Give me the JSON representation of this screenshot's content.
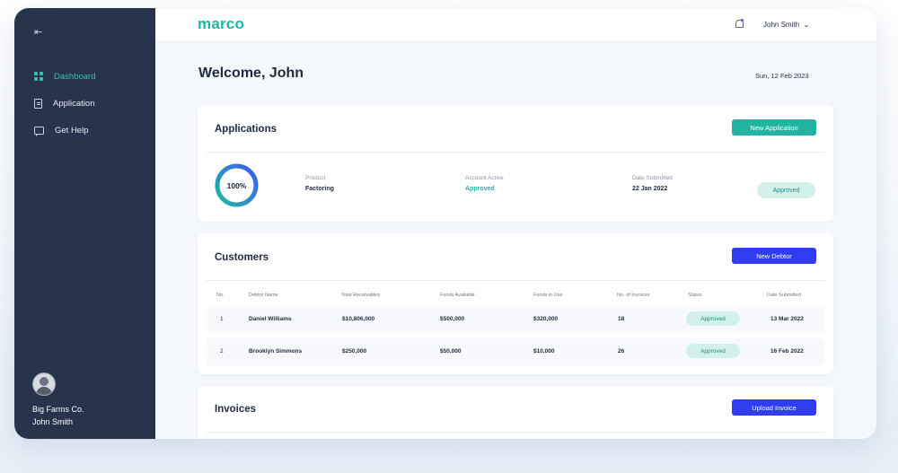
{
  "sidebar": {
    "collapse_icon": "⇤",
    "items": [
      {
        "label": "Dashboard",
        "icon": "dashboard-icon",
        "active": true
      },
      {
        "label": "Application",
        "icon": "clipboard-icon",
        "active": false
      },
      {
        "label": "Get Help",
        "icon": "chat-icon",
        "active": false
      }
    ],
    "company": "Big Farms Co.",
    "user": "John Smith"
  },
  "header": {
    "logo": "marco",
    "user_name": "John Smith",
    "chevron": "⌄"
  },
  "page": {
    "welcome": "Welcome, John",
    "date": "Sun, 12 Feb 2023"
  },
  "applications": {
    "title": "Applications",
    "new_button": "New Application",
    "progress": 100,
    "progress_label": "100%",
    "product_label": "Product",
    "product_value": "Factoring",
    "account_label": "Account Active",
    "account_value": "Approved",
    "date_label": "Date Submitted",
    "date_value": "22 Jan 2022",
    "status": "Approved"
  },
  "customers": {
    "title": "Customers",
    "new_button": "New Debtor",
    "columns": [
      "No.",
      "Debtor Name",
      "Total Receivables",
      "Funds Available",
      "Funds in Use",
      "No. of Invoices",
      "Status",
      "Date Submitted"
    ],
    "rows": [
      {
        "no": "1",
        "name": "Daniel Williams",
        "receivables": "$10,806,000",
        "available": "$500,000",
        "in_use": "$320,000",
        "invoices": "18",
        "status": "Approved",
        "date": "13 Mar 2022"
      },
      {
        "no": "2",
        "name": "Brooklyn Simmons",
        "receivables": "$250,000",
        "available": "$50,000",
        "in_use": "$10,000",
        "invoices": "26",
        "status": "Approved",
        "date": "16 Feb 2022"
      }
    ]
  },
  "invoices": {
    "title": "Invoices",
    "upload_button": "Upload Invoice"
  },
  "colors": {
    "sidebar": "#28344c",
    "accent_teal": "#22b3a3",
    "accent_blue": "#2f3df0",
    "ring_start": "#23b8a6",
    "ring_end": "#3a5cf0"
  }
}
